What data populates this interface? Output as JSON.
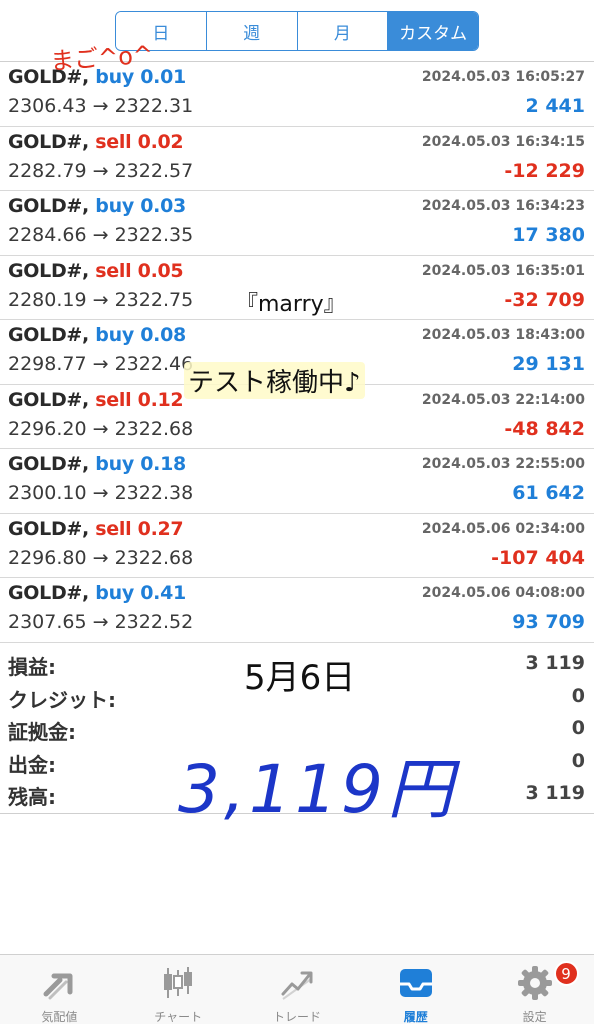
{
  "period_tabs": [
    {
      "label": "日",
      "active": false
    },
    {
      "label": "週",
      "active": false
    },
    {
      "label": "月",
      "active": false
    },
    {
      "label": "カスタム",
      "active": true
    }
  ],
  "trades": [
    {
      "symbol": "GOLD#,",
      "side": "buy",
      "volume": "0.01",
      "time": "2024.05.03 16:05:27",
      "open": "2306.43",
      "close": "2322.31",
      "profit": "2 441"
    },
    {
      "symbol": "GOLD#,",
      "side": "sell",
      "volume": "0.02",
      "time": "2024.05.03 16:34:15",
      "open": "2282.79",
      "close": "2322.57",
      "profit": "-12 229"
    },
    {
      "symbol": "GOLD#,",
      "side": "buy",
      "volume": "0.03",
      "time": "2024.05.03 16:34:23",
      "open": "2284.66",
      "close": "2322.35",
      "profit": "17 380"
    },
    {
      "symbol": "GOLD#,",
      "side": "sell",
      "volume": "0.05",
      "time": "2024.05.03 16:35:01",
      "open": "2280.19",
      "close": "2322.75",
      "profit": "-32 709"
    },
    {
      "symbol": "GOLD#,",
      "side": "buy",
      "volume": "0.08",
      "time": "2024.05.03 18:43:00",
      "open": "2298.77",
      "close": "2322.46",
      "profit": "29 131"
    },
    {
      "symbol": "GOLD#,",
      "side": "sell",
      "volume": "0.12",
      "time": "2024.05.03 22:14:00",
      "open": "2296.20",
      "close": "2322.68",
      "profit": "-48 842"
    },
    {
      "symbol": "GOLD#,",
      "side": "buy",
      "volume": "0.18",
      "time": "2024.05.03 22:55:00",
      "open": "2300.10",
      "close": "2322.38",
      "profit": "61 642"
    },
    {
      "symbol": "GOLD#,",
      "side": "sell",
      "volume": "0.27",
      "time": "2024.05.06 02:34:00",
      "open": "2296.80",
      "close": "2322.68",
      "profit": "-107 404"
    },
    {
      "symbol": "GOLD#,",
      "side": "buy",
      "volume": "0.41",
      "time": "2024.05.06 04:08:00",
      "open": "2307.65",
      "close": "2322.52",
      "profit": "93 709"
    }
  ],
  "arrow": "→",
  "summary": [
    {
      "label": "損益:",
      "value": "3 119"
    },
    {
      "label": "クレジット:",
      "value": "0"
    },
    {
      "label": "証拠金:",
      "value": "0"
    },
    {
      "label": "出金:",
      "value": "0"
    },
    {
      "label": "残高:",
      "value": "3 119"
    }
  ],
  "annotations": {
    "top_note": "まご^o^",
    "marry": "『marry』",
    "test": "テスト稼働中♪",
    "date": "5月6日",
    "yen": "3,119円"
  },
  "tabbar": [
    {
      "label": "気配値",
      "icon": "quotes-arrows-icon",
      "active": false
    },
    {
      "label": "チャート",
      "icon": "candlestick-chart-icon",
      "active": false
    },
    {
      "label": "トレード",
      "icon": "trade-trend-icon",
      "active": false
    },
    {
      "label": "履歴",
      "icon": "history-inbox-icon",
      "active": true
    },
    {
      "label": "設定",
      "icon": "settings-gear-icon",
      "active": false,
      "badge": "9"
    }
  ],
  "colors": {
    "accent": "#3a8cd9",
    "buy": "#1f7fd8",
    "sell": "#e0301e",
    "handwriting_blue": "#1c36c8"
  }
}
